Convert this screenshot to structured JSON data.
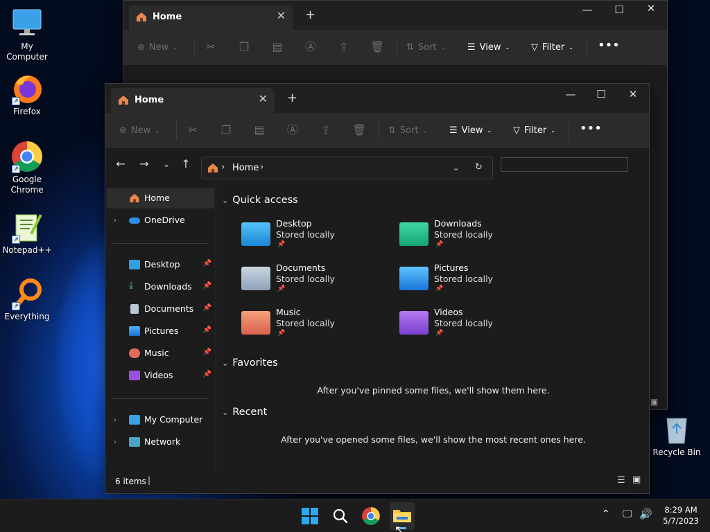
{
  "desktop": {
    "icons": [
      {
        "name": "my-computer",
        "label": "My Computer"
      },
      {
        "name": "firefox",
        "label": "Firefox"
      },
      {
        "name": "chrome",
        "label": "Google Chrome"
      },
      {
        "name": "notepadpp",
        "label": "Notepad++"
      },
      {
        "name": "everything",
        "label": "Everything"
      },
      {
        "name": "recycle-bin",
        "label": "Recycle Bin"
      }
    ]
  },
  "back_window": {
    "tab_title": "Home",
    "commands": {
      "new": "New",
      "sort": "Sort",
      "view": "View",
      "filter": "Filter"
    }
  },
  "window": {
    "tab_title": "Home",
    "commands": {
      "new": "New",
      "sort": "Sort",
      "view": "View",
      "filter": "Filter"
    },
    "address": {
      "current": "Home"
    },
    "search": {
      "placeholder": ""
    },
    "sidebar": {
      "items": [
        {
          "label": "Home",
          "selected": true
        },
        {
          "label": "OneDrive"
        },
        {
          "label": "Desktop",
          "pinned": true
        },
        {
          "label": "Downloads",
          "pinned": true
        },
        {
          "label": "Documents",
          "pinned": true
        },
        {
          "label": "Pictures",
          "pinned": true
        },
        {
          "label": "Music",
          "pinned": true
        },
        {
          "label": "Videos",
          "pinned": true
        },
        {
          "label": "My Computer"
        },
        {
          "label": "Network"
        }
      ]
    },
    "sections": {
      "quick_access": "Quick access",
      "favorites": "Favorites",
      "recent": "Recent"
    },
    "quick_access": [
      {
        "name": "Desktop",
        "sub": "Stored locally"
      },
      {
        "name": "Downloads",
        "sub": "Stored locally"
      },
      {
        "name": "Documents",
        "sub": "Stored locally"
      },
      {
        "name": "Pictures",
        "sub": "Stored locally"
      },
      {
        "name": "Music",
        "sub": "Stored locally"
      },
      {
        "name": "Videos",
        "sub": "Stored locally"
      }
    ],
    "favorites_empty": "After you've pinned some files, we'll show them here.",
    "recent_empty": "After you've opened some files, we'll show the most recent ones here.",
    "status": {
      "items": "6 items"
    }
  },
  "taskbar": {
    "time": "8:29 AM",
    "date": "5/7/2023"
  },
  "colors": {
    "accent": "#0078d4",
    "window_bg": "#1c1c1c",
    "titlebar": "#202020",
    "cmdbar": "#2b2b2b"
  }
}
